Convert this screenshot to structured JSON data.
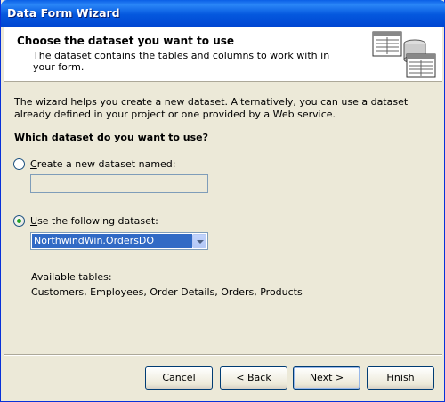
{
  "window": {
    "title": "Data Form Wizard"
  },
  "header": {
    "title": "Choose the dataset you want to use",
    "subtitle": "The dataset contains the tables and columns to work with in your form."
  },
  "intro": "The wizard helps you create a new dataset. Alternatively, you can use a dataset already defined in your project or one provided by a Web service.",
  "question": "Which dataset do you want to use?",
  "options": {
    "create_new": {
      "label_prefix": "",
      "label_mnemonic": "C",
      "label_rest": "reate a new dataset named:",
      "checked": false,
      "value": ""
    },
    "use_existing": {
      "label_prefix": "",
      "label_mnemonic": "U",
      "label_rest": "se the following dataset:",
      "checked": true,
      "selected": "NorthwindWin.OrdersDO"
    }
  },
  "available_tables": {
    "label": "Available tables:",
    "list": "Customers, Employees, Order Details, Orders, Products"
  },
  "buttons": {
    "cancel": "Cancel",
    "back_prefix": "< ",
    "back_mnemonic": "B",
    "back_rest": "ack",
    "next_mnemonic": "N",
    "next_rest": "ext >",
    "finish_mnemonic": "F",
    "finish_rest": "inish"
  },
  "colors": {
    "titlebar": "#0458de",
    "selection": "#316ac5",
    "face": "#ece9d8"
  }
}
